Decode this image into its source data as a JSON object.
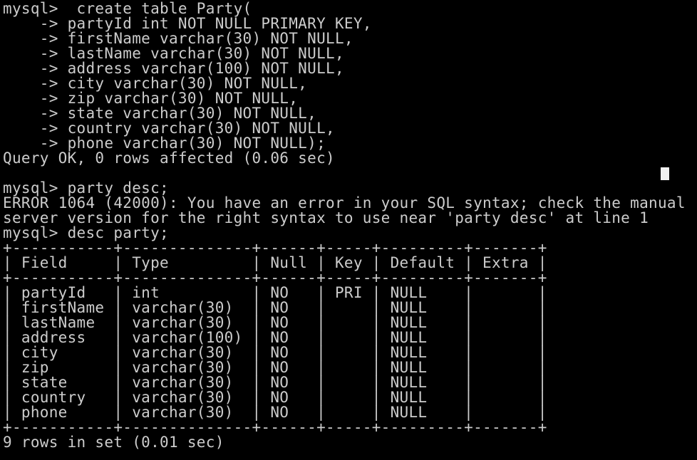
{
  "terminal": {
    "colors": {
      "background": "#000000",
      "text": "#cccccc",
      "cursor": "#f2f2f2"
    },
    "lines": [
      "mysql>  create table Party(",
      "    -> partyId int NOT NULL PRIMARY KEY,",
      "    -> firstName varchar(30) NOT NULL,",
      "    -> lastName varchar(30) NOT NULL,",
      "    -> address varchar(100) NOT NULL,",
      "    -> city varchar(30) NOT NULL,",
      "    -> zip varchar(30) NOT NULL,",
      "    -> state varchar(30) NOT NULL,",
      "    -> country varchar(30) NOT NULL,",
      "    -> phone varchar(30) NOT NULL);",
      "Query OK, 0 rows affected (0.06 sec)",
      "",
      "mysql> party desc;",
      "ERROR 1064 (42000): You have an error in your SQL syntax; check the manual",
      "server version for the right syntax to use near 'party desc' at line 1",
      "mysql> desc party;",
      "+-----------+--------------+------+-----+---------+-------+",
      "| Field     | Type         | Null | Key | Default | Extra |",
      "+-----------+--------------+------+-----+---------+-------+",
      "| partyId   | int          | NO   | PRI | NULL    |       |",
      "| firstName | varchar(30)  | NO   |     | NULL    |       |",
      "| lastName  | varchar(30)  | NO   |     | NULL    |       |",
      "| address   | varchar(100) | NO   |     | NULL    |       |",
      "| city      | varchar(30)  | NO   |     | NULL    |       |",
      "| zip       | varchar(30)  | NO   |     | NULL    |       |",
      "| state     | varchar(30)  | NO   |     | NULL    |       |",
      "| country   | varchar(30)  | NO   |     | NULL    |       |",
      "| phone     | varchar(30)  | NO   |     | NULL    |       |",
      "+-----------+--------------+------+-----+---------+-------+",
      "9 rows in set (0.01 sec)"
    ]
  }
}
